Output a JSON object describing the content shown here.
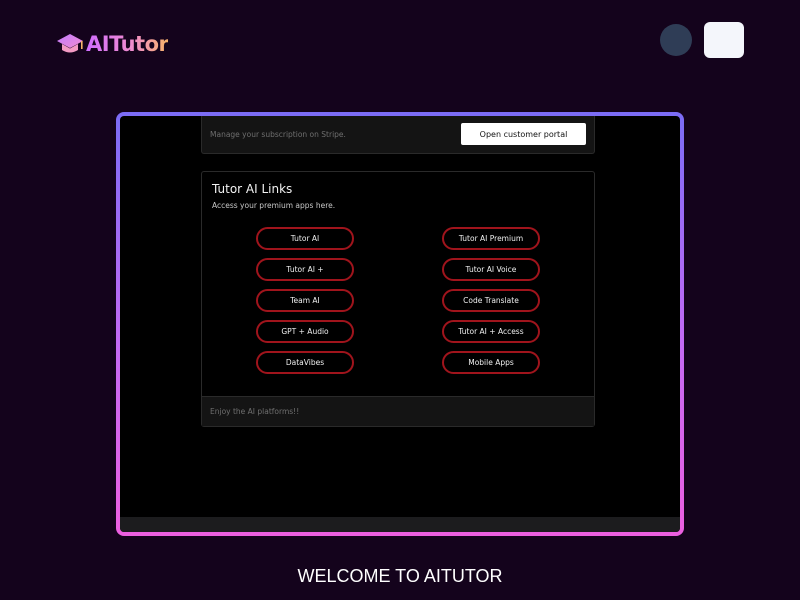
{
  "header": {
    "logo_text": "AITutor",
    "logo_icon": "graduation-cap-icon"
  },
  "subscription": {
    "text": "Manage your subscription on Stripe.",
    "button_label": "Open customer portal"
  },
  "links_card": {
    "title": "Tutor AI Links",
    "subtitle": "Access your premium apps here.",
    "left_links": [
      "Tutor AI",
      "Tutor AI +",
      "Team AI",
      "GPT + Audio",
      "DataVibes"
    ],
    "right_links": [
      "Tutor AI Premium",
      "Tutor AI Voice",
      "Code Translate",
      "Tutor AI + Access",
      "Mobile Apps"
    ],
    "footer": "Enjoy the AI platforms!!"
  },
  "welcome_text": "WELCOME TO AITUTOR",
  "colors": {
    "background": "#14031c",
    "frame_gradient_top": "#7b6cf6",
    "frame_gradient_bottom": "#ec5fe0",
    "pill_border": "#a0141c",
    "avatar": "#2f3d56"
  }
}
